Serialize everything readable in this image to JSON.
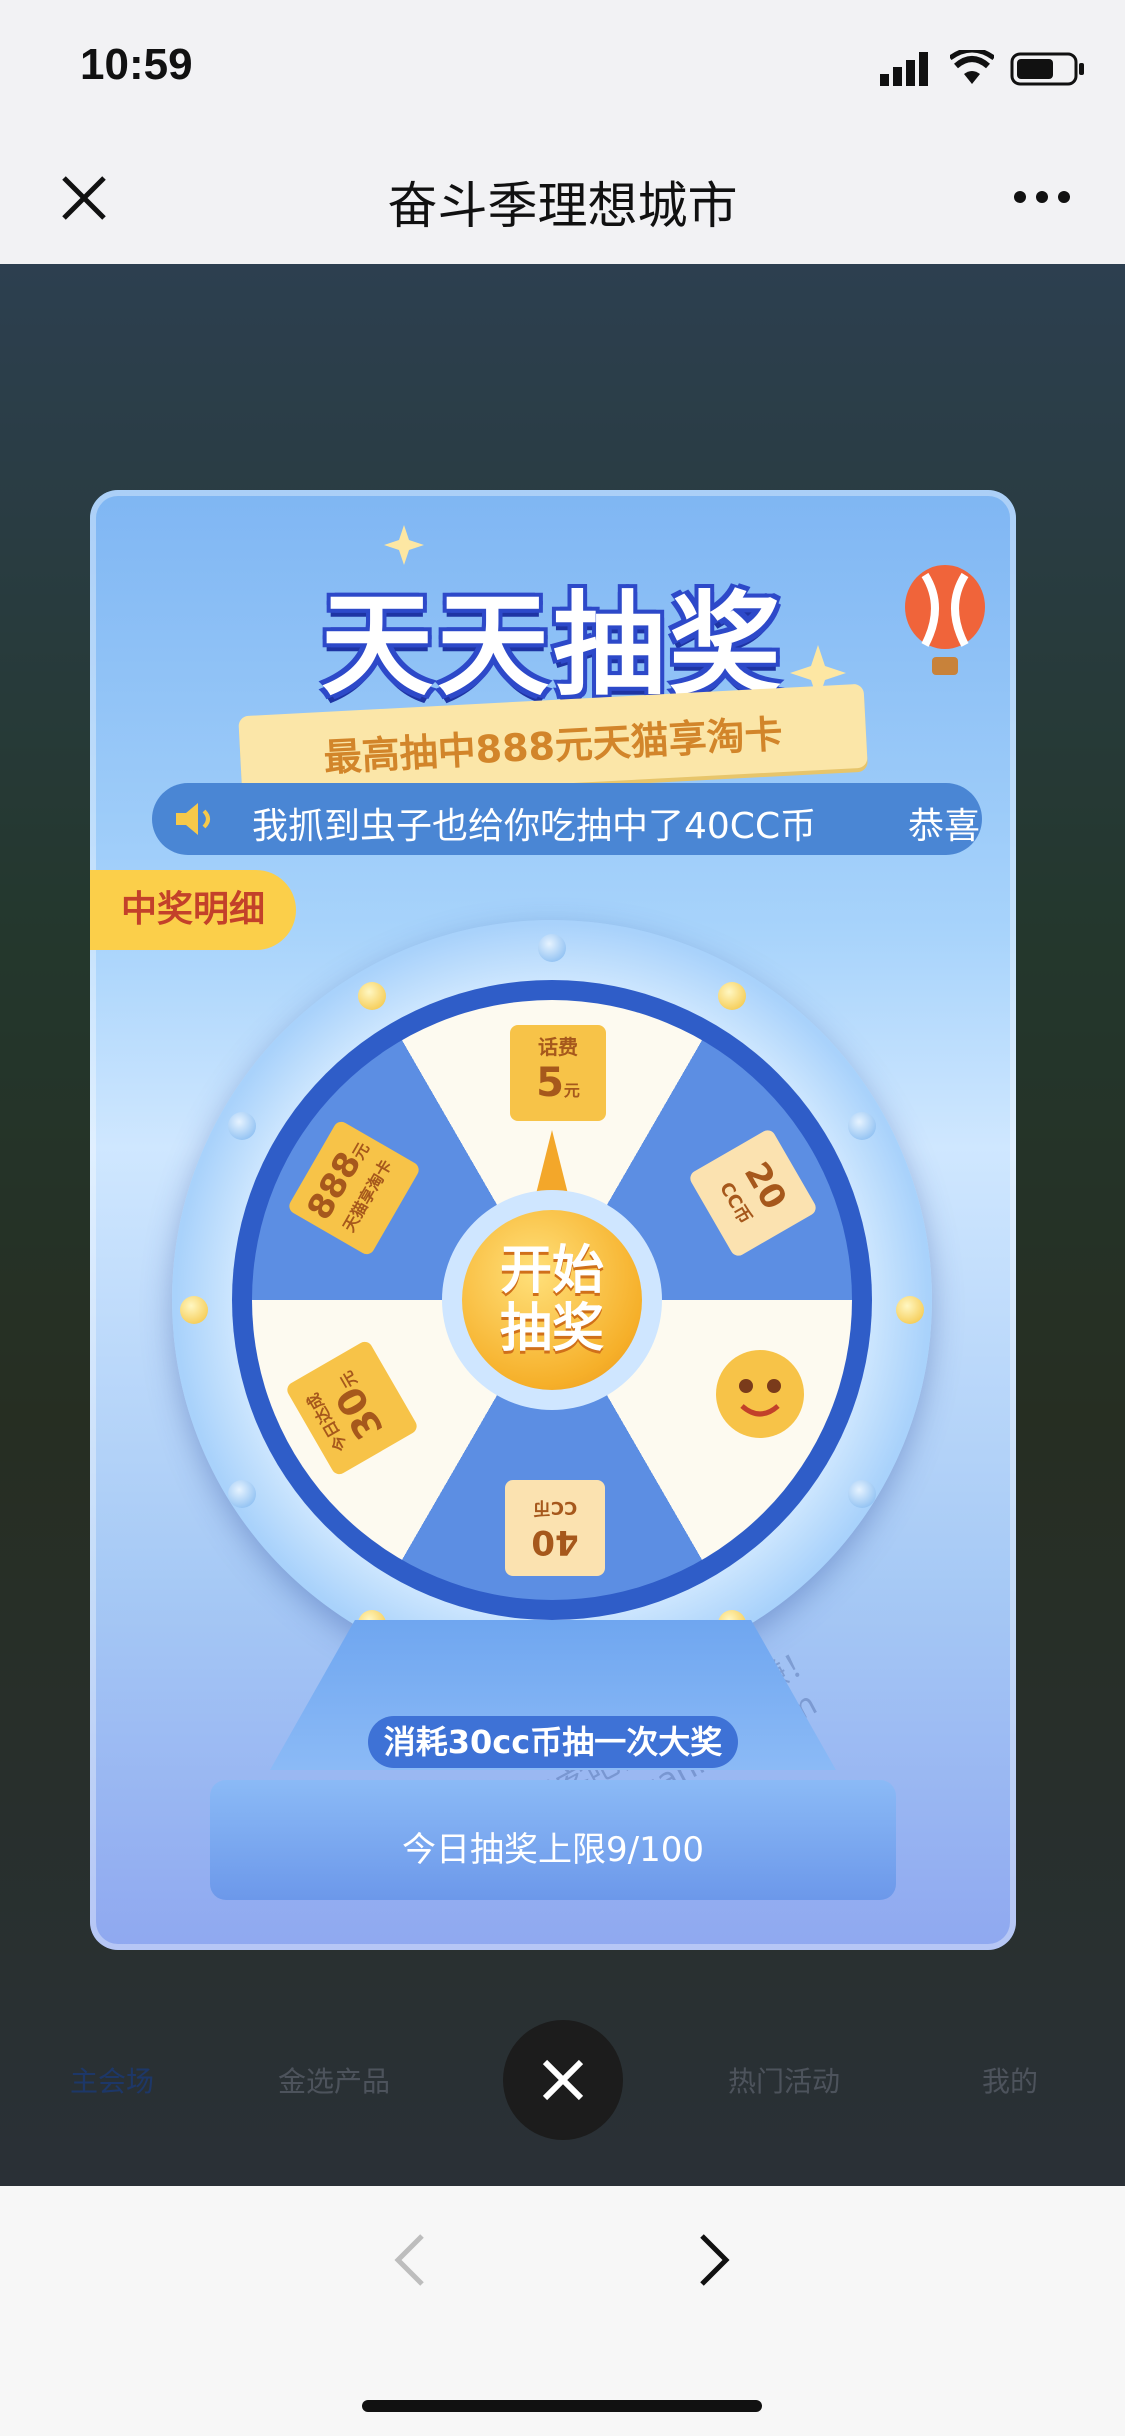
{
  "status_bar": {
    "time": "10:59"
  },
  "nav": {
    "title": "奋斗季理想城市",
    "close_icon": "close-icon",
    "more_icon": "more-icon"
  },
  "tabbar": {
    "items": [
      "主会场",
      "金选产品",
      "热门活动",
      "我的"
    ]
  },
  "modal": {
    "title": "天天抽奖",
    "subtitle": "最高抽中888元天猫享淘卡",
    "marquee": "我抓到虫子也给你吃抽中了40CC币",
    "marquee_next": "恭喜",
    "detail_tag": "中奖明细",
    "start_button": "开始\n抽奖",
    "consume": "消耗30cc币抽一次大奖",
    "limit": "今日抽奖上限9/100",
    "watermark": "赚客吧，有奖一起赚！ www.zuanke8.com"
  },
  "wheel": {
    "prizes": [
      {
        "label": "话费",
        "value": "5",
        "unit": "元"
      },
      {
        "value": "20",
        "unit": "CC币"
      },
      {
        "icon": "smiley-icon"
      },
      {
        "value": "40",
        "unit": "CC币"
      },
      {
        "value": "30",
        "unit": "元",
        "label": "今日达成"
      },
      {
        "value": "888",
        "unit": "元",
        "label": "天猫享淘卡"
      }
    ]
  },
  "colors": {
    "accent": "#2f5dc8",
    "gold": "#f6b02a"
  }
}
